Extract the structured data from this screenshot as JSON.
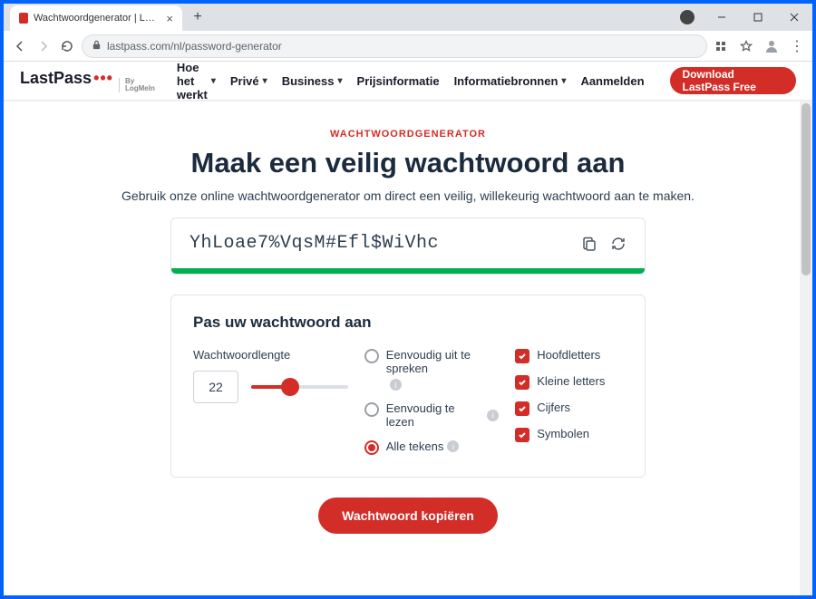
{
  "browser": {
    "tab_title": "Wachtwoordgenerator | LastPass",
    "url": "lastpass.com/nl/password-generator"
  },
  "nav": {
    "logo_last": "Last",
    "logo_pass": "Pass",
    "logo_dots": "•••",
    "logo_by": "By\nLogMeIn",
    "links": {
      "how": "Hoe het werkt",
      "prive": "Privé",
      "business": "Business",
      "pricing": "Prijsinformatie",
      "resources": "Informatiebronnen",
      "login": "Aanmelden"
    },
    "download": "Download LastPass Free"
  },
  "hero": {
    "eyebrow": "WACHTWOORDGENERATOR",
    "title": "Maak een veilig wachtwoord aan",
    "subline": "Gebruik onze online wachtwoordgenerator om direct een veilig, willekeurig wachtwoord aan te maken."
  },
  "password": {
    "value": "YhLoae7%VqsM#Efl$WiVhc"
  },
  "customize": {
    "title": "Pas uw wachtwoord aan",
    "length_label": "Wachtwoordlengte",
    "length": "22",
    "radio": {
      "easy_say": "Eenvoudig uit te spreken",
      "easy_read": "Eenvoudig te lezen",
      "all_chars": "Alle tekens"
    },
    "checks": {
      "upper": "Hoofdletters",
      "lower": "Kleine letters",
      "digits": "Cijfers",
      "symbols": "Symbolen"
    }
  },
  "copy_btn": "Wachtwoord kopiëren"
}
